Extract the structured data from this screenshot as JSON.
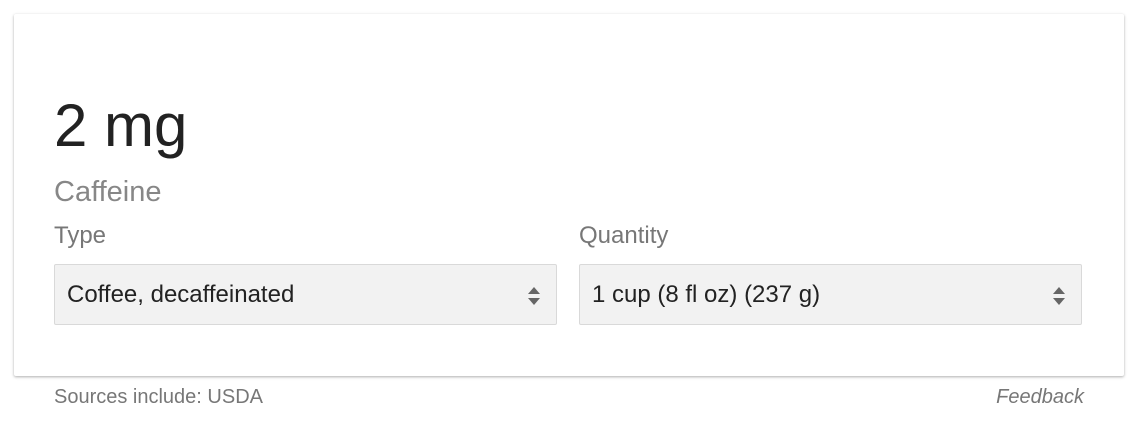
{
  "result": {
    "amount": "2 mg",
    "nutrient": "Caffeine"
  },
  "type_field": {
    "label": "Type",
    "selected": "Coffee, decaffeinated",
    "icon": "select-arrows-icon"
  },
  "quantity_field": {
    "label": "Quantity",
    "selected": "1 cup (8 fl oz) (237 g)",
    "icon": "select-arrows-icon"
  },
  "footer": {
    "sources": "Sources include: USDA",
    "feedback": "Feedback"
  },
  "colors": {
    "amount_text": "#222222",
    "secondary_text": "#777777",
    "select_background": "#f2f2f2",
    "select_border": "#d9d9d9"
  }
}
